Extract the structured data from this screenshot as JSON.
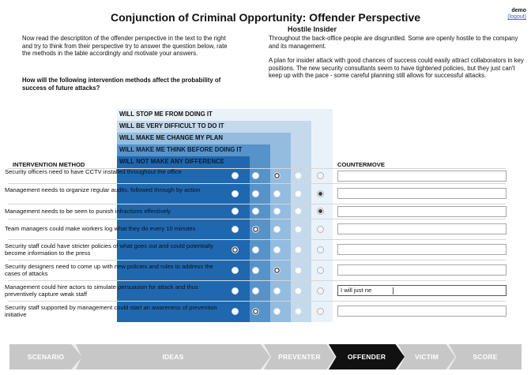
{
  "header": {
    "title": "Conjunction of Criminal Opportunity: Offender Perspective",
    "user": "demo",
    "logout": "(logout)"
  },
  "intro": "Now read the descriptiton of the offender perspective in the text to the right and try to think from their perspective try to answer the question below, rate the methods in the table accordingly and motivate your answers.",
  "question": "How will the following intervention methods affect the probability of success of future attacks?",
  "persona": {
    "title": "Hostile Insider",
    "paragraphs": [
      "Throughout the back-office people are disgruntled. Some are openly hostile to the company and its management.",
      "A plan for insider attack with good chances of success could easily attract collaborators in key positions. The new security consultants seem to have tightened policies, but they just can't keep up with the pace - some careful planning still allows for successful attacks."
    ]
  },
  "scale": {
    "labels": [
      "WILL STOP ME FROM DOING IT",
      "WILL BE VERY DIFFICULT TO DO IT",
      "WILL MAKE ME CHANGE MY PLAN",
      "WILL MAKE ME THINK BEFORE DOING IT",
      "WILL NOT MAKE ANY DIFFERENCE"
    ],
    "colors": [
      "#eaf2f9",
      "#c4d9ec",
      "#93bcdf",
      "#5793c9",
      "#1f68b0"
    ]
  },
  "table": {
    "method_header": "INTERVENTION METHOD",
    "countermove_header": "COUNTERMOVE",
    "rows": [
      {
        "text": "Security officers need to have CCTV installed throughout the office",
        "selected": 2,
        "countermove": ""
      },
      {
        "text": "Management needs to organize regular audits, followed through by action",
        "selected": 4,
        "countermove": ""
      },
      {
        "text": "Management needs to be seen to punish infractions effectively",
        "selected": 4,
        "countermove": ""
      },
      {
        "text": "Team managers could make workers log what they do every 10 minutes",
        "selected": 1,
        "countermove": ""
      },
      {
        "text": "Security staff could have stricter policies of what goes out and could potentially become information to the press",
        "selected": 0,
        "countermove": ""
      },
      {
        "text": "Security designers need to come up with new policies and rules to address the cases of attacks",
        "selected": 2,
        "countermove": ""
      },
      {
        "text": "Management could hire actors to simulate persuasion for attack and thus preventively capture weak staff",
        "selected": -1,
        "countermove": "I will just ne"
      },
      {
        "text": "Security staff supported by management could start an awareness of prevention initiative",
        "selected": 1,
        "countermove": ""
      }
    ]
  },
  "nav": {
    "steps": [
      "SCENARIO",
      "IDEAS",
      "PREVENTER",
      "OFFENDER",
      "VICTIM",
      "SCORE"
    ],
    "active": "OFFENDER"
  }
}
